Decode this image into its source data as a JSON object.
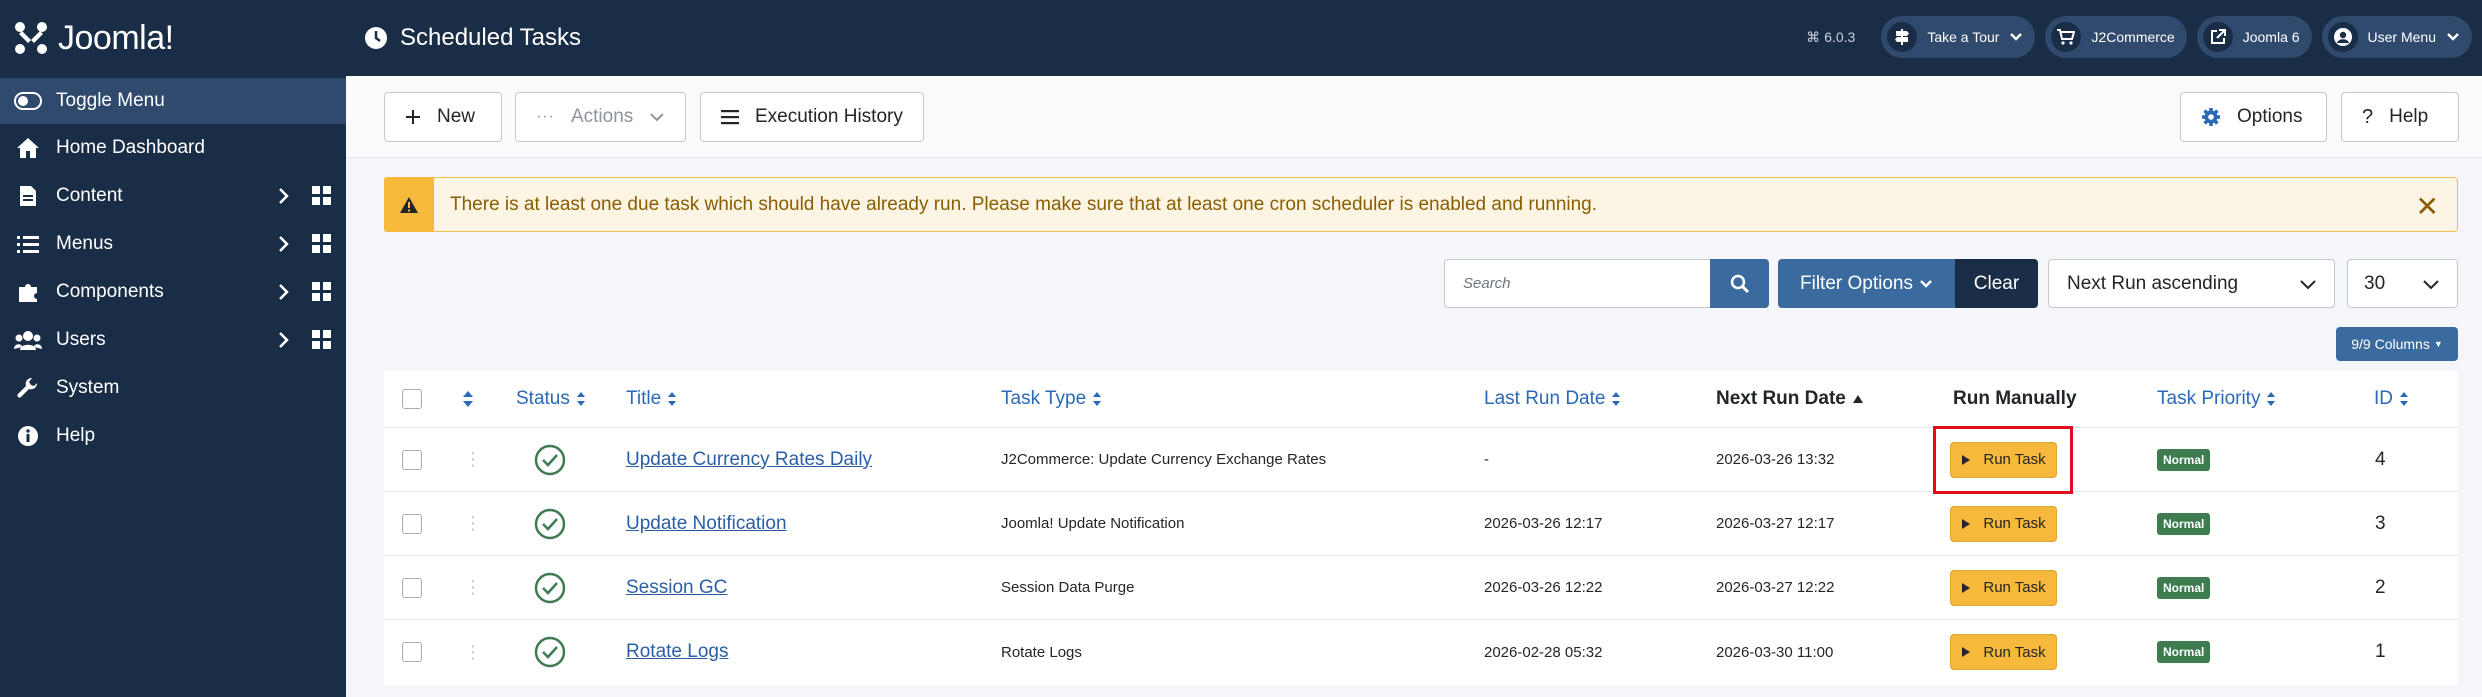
{
  "sidebar": {
    "logo_text": "Joomla!",
    "items": [
      {
        "label": "Toggle Menu",
        "icon": "toggle-icon"
      },
      {
        "label": "Home Dashboard",
        "icon": "home-icon"
      },
      {
        "label": "Content",
        "icon": "file-icon"
      },
      {
        "label": "Menus",
        "icon": "list-icon"
      },
      {
        "label": "Components",
        "icon": "puzzle-icon"
      },
      {
        "label": "Users",
        "icon": "users-icon"
      },
      {
        "label": "System",
        "icon": "wrench-icon"
      },
      {
        "label": "Help",
        "icon": "info-icon"
      }
    ]
  },
  "header": {
    "title": "Scheduled Tasks",
    "version": "6.0.3",
    "buttons": [
      {
        "label": "Take a Tour",
        "icon": "signpost-icon"
      },
      {
        "label": "J2Commerce",
        "icon": "cart-icon"
      },
      {
        "label": "Joomla 6",
        "icon": "external-link-icon"
      },
      {
        "label": "User Menu",
        "icon": "user-circle-icon"
      }
    ]
  },
  "toolbar": {
    "new_label": "New",
    "actions_label": "Actions",
    "history_label": "Execution History",
    "options_label": "Options",
    "help_label": "Help"
  },
  "alert": {
    "message": "There is at least one due task which should have already run. Please make sure that at least one cron scheduler is enabled and running."
  },
  "filters": {
    "search_placeholder": "Search",
    "filter_options_label": "Filter Options",
    "clear_label": "Clear",
    "sort_value": "Next Run ascending",
    "limit_value": "30",
    "columns_label": "9/9 Columns"
  },
  "table": {
    "headers": {
      "status": "Status",
      "title": "Title",
      "task_type": "Task Type",
      "last_run": "Last Run Date",
      "next_run": "Next Run Date",
      "run_manually": "Run Manually",
      "priority": "Task Priority",
      "id": "ID"
    },
    "rows": [
      {
        "title": "Update Currency Rates Daily",
        "type": "J2Commerce: Update Currency Exchange Rates",
        "last_run": "-",
        "next_run": "2026-03-26 13:32",
        "run_label": "Run Task",
        "priority": "Normal",
        "id": "4"
      },
      {
        "title": "Update Notification",
        "type": "Joomla! Update Notification",
        "last_run": "2026-03-26 12:17",
        "next_run": "2026-03-27 12:17",
        "run_label": "Run Task",
        "priority": "Normal",
        "id": "3"
      },
      {
        "title": "Session GC",
        "type": "Session Data Purge",
        "last_run": "2026-03-26 12:22",
        "next_run": "2026-03-27 12:22",
        "run_label": "Run Task",
        "priority": "Normal",
        "id": "2"
      },
      {
        "title": "Rotate Logs",
        "type": "Rotate Logs",
        "last_run": "2026-02-28 05:32",
        "next_run": "2026-03-30 11:00",
        "run_label": "Run Task",
        "priority": "Normal",
        "id": "1"
      }
    ]
  }
}
